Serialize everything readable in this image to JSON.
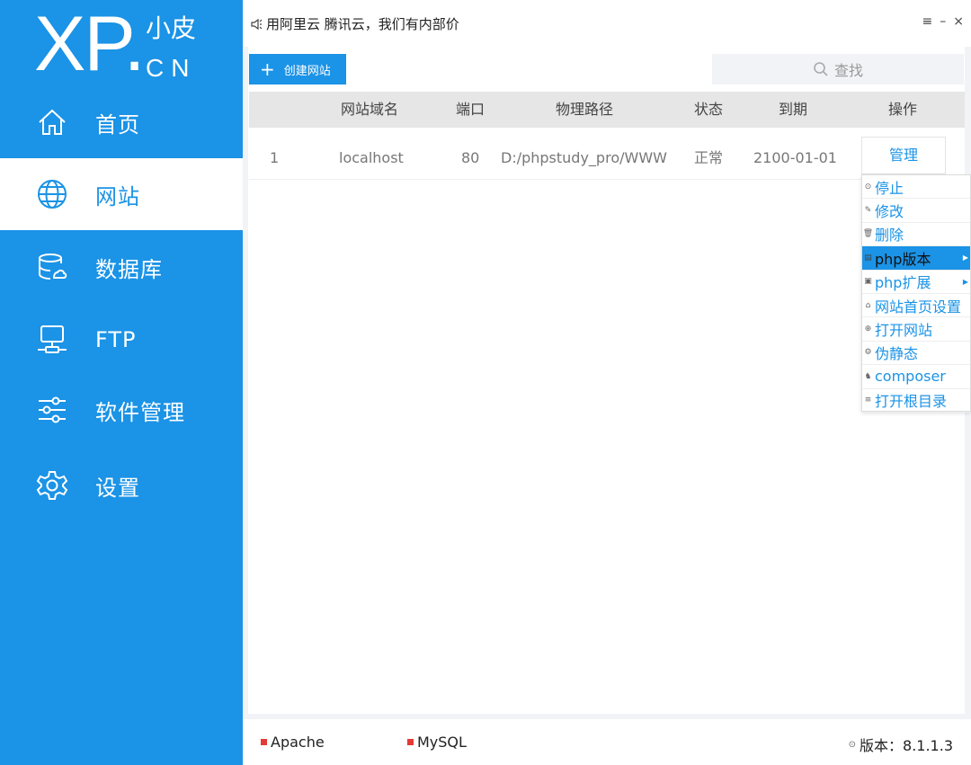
{
  "brand": {
    "logo_main": "XP.",
    "logo_cn_top": "小皮",
    "logo_cn_bottom": "CN"
  },
  "sidebar": {
    "items": [
      {
        "label": "首页",
        "icon": "home-icon",
        "active": false
      },
      {
        "label": "网站",
        "icon": "globe-icon",
        "active": true
      },
      {
        "label": "数据库",
        "icon": "database-icon",
        "active": false
      },
      {
        "label": "FTP",
        "icon": "ftp-monitor-icon",
        "active": false
      },
      {
        "label": "软件管理",
        "icon": "sliders-icon",
        "active": false
      },
      {
        "label": "设置",
        "icon": "gear-icon",
        "active": false
      }
    ]
  },
  "header": {
    "notice": "用阿里云 腾讯云，我们有内部价",
    "notice_icon": "speaker-icon",
    "window_controls": [
      "≡",
      "–",
      "×"
    ]
  },
  "toolbar": {
    "create_label": "创建网站",
    "search_placeholder": "查找"
  },
  "table": {
    "columns": [
      "网站域名",
      "端口",
      "物理路径",
      "状态",
      "到期",
      "操作"
    ],
    "rows": [
      {
        "index": "1",
        "domain": "localhost",
        "port": "80",
        "path": "D:/phpstudy_pro/WWW",
        "status": "正常",
        "expire": "2100-01-01",
        "action": "管理"
      }
    ]
  },
  "context_menu": {
    "items": [
      {
        "label": "停止",
        "icon": "stop-icon",
        "glyph": "⊙",
        "highlighted": false,
        "submenu": false
      },
      {
        "label": "修改",
        "icon": "edit-icon",
        "glyph": "✎",
        "highlighted": false,
        "submenu": false
      },
      {
        "label": "删除",
        "icon": "trash-icon",
        "glyph": "🗑",
        "highlighted": false,
        "submenu": false
      },
      {
        "label": "php版本",
        "icon": "php-version-icon",
        "glyph": "▤",
        "highlighted": true,
        "submenu": true
      },
      {
        "label": "php扩展",
        "icon": "php-extension-icon",
        "glyph": "▣",
        "highlighted": false,
        "submenu": true
      },
      {
        "label": "网站首页设置",
        "icon": "home-setting-icon",
        "glyph": "⌂",
        "highlighted": false,
        "submenu": false
      },
      {
        "label": "打开网站",
        "icon": "open-site-icon",
        "glyph": "⊕",
        "highlighted": false,
        "submenu": false
      },
      {
        "label": "伪静态",
        "icon": "rewrite-icon",
        "glyph": "⚙",
        "highlighted": false,
        "submenu": false
      },
      {
        "label": "composer",
        "icon": "composer-icon",
        "glyph": "♞",
        "highlighted": false,
        "submenu": false
      },
      {
        "label": "打开根目录",
        "icon": "folder-list-icon",
        "glyph": "≡",
        "highlighted": false,
        "submenu": false
      }
    ]
  },
  "statusbar": {
    "services": [
      {
        "label": "Apache",
        "status_color": "#e53935"
      },
      {
        "label": "MySQL",
        "status_color": "#e53935"
      }
    ],
    "version_label": "版本：8.1.1.3"
  },
  "colors": {
    "accent": "#1b93e6",
    "background": "#f1f3f6",
    "stopped": "#e53935"
  }
}
